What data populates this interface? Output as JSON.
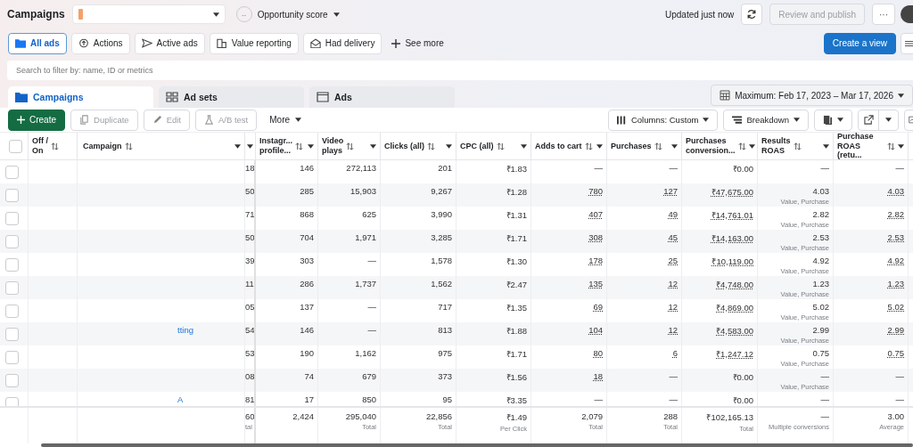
{
  "header": {
    "title": "Campaigns",
    "opportunity": {
      "badge": "--",
      "label": "Opportunity score"
    },
    "updated": "Updated just now",
    "publish": {
      "label": "Review and publish",
      "disabled": true
    },
    "more": "···"
  },
  "filters": [
    {
      "label": "All ads",
      "selected": true
    },
    {
      "label": "Actions",
      "selected": false
    },
    {
      "label": "Active ads",
      "selected": false
    },
    {
      "label": "Value reporting",
      "selected": false
    },
    {
      "label": "Had delivery",
      "selected": false
    }
  ],
  "see_more": "See more",
  "create_view": "Create a view",
  "search": {
    "placeholder": "Search to filter by: name, ID or metrics"
  },
  "tabs": [
    {
      "label": "Campaigns",
      "selected": true
    },
    {
      "label": "Ad sets",
      "selected": false
    },
    {
      "label": "Ads",
      "selected": false
    }
  ],
  "date_range": "Maximum: Feb 17, 2023 – Mar 17, 2026",
  "toolbar": [
    {
      "label": "Create",
      "kind": "primary",
      "disabled": false
    },
    {
      "label": "Duplicate",
      "kind": "button",
      "disabled": true
    },
    {
      "label": "Edit",
      "kind": "button",
      "disabled": true
    },
    {
      "label": "A/B test",
      "kind": "button",
      "disabled": true
    },
    {
      "label": "More",
      "kind": "menu",
      "disabled": false
    }
  ],
  "view_tools": [
    {
      "label": "Columns: Custom"
    },
    {
      "label": "Breakdown"
    }
  ],
  "table": {
    "all_checked": false,
    "columns": [
      "Off /\nOn",
      "Campaign",
      "Instagr...\nprofile...",
      "Video\nplays",
      "Clicks (all)",
      "CPC (all)",
      "Adds to cart",
      "Purchases",
      "Purchases\nconversion...",
      "Results\nROAS",
      "Purchase\nROAS (retu..."
    ],
    "rows": [
      {
        "checked": false,
        "column_3": "18",
        "cells": [
          "146",
          "272,113",
          "201",
          "₹1.83",
          "—",
          "—",
          "₹0.00",
          "—",
          "—"
        ]
      },
      {
        "checked": false,
        "column_3": "50",
        "cells": [
          "285",
          "15,903",
          "9,267",
          "₹1.28",
          {
            "text": "780",
            "link": true
          },
          {
            "text": "127",
            "link": true
          },
          {
            "text": "₹47,675.00",
            "link": true
          },
          {
            "text": "4.03",
            "note": "Value, Purchase"
          },
          {
            "text": "4.03",
            "link": true
          }
        ]
      },
      {
        "checked": false,
        "column_3": "71",
        "cells": [
          "868",
          "625",
          "3,990",
          "₹1.31",
          {
            "text": "407",
            "link": true
          },
          {
            "text": "49",
            "link": true
          },
          {
            "text": "₹14,761.01",
            "link": true
          },
          {
            "text": "2.82",
            "note": "Value, Purchase"
          },
          {
            "text": "2.82",
            "link": true
          }
        ]
      },
      {
        "checked": false,
        "column_3": "50",
        "cells": [
          "704",
          "1,971",
          "3,285",
          "₹1.71",
          {
            "text": "308",
            "link": true
          },
          {
            "text": "45",
            "link": true
          },
          {
            "text": "₹14,163.00",
            "link": true
          },
          {
            "text": "2.53",
            "note": "Value, Purchase"
          },
          {
            "text": "2.53",
            "link": true
          }
        ]
      },
      {
        "checked": false,
        "column_3": "39",
        "cells": [
          "303",
          "—",
          "1,578",
          "₹1.30",
          {
            "text": "178",
            "link": true
          },
          {
            "text": "25",
            "link": true
          },
          {
            "text": "₹10,119.00",
            "link": true
          },
          {
            "text": "4.92",
            "note": "Value, Purchase"
          },
          {
            "text": "4.92",
            "link": true
          }
        ]
      },
      {
        "checked": false,
        "column_3": "11",
        "cells": [
          "286",
          "1,737",
          "1,562",
          "₹2.47",
          {
            "text": "135",
            "link": true
          },
          {
            "text": "12",
            "link": true
          },
          {
            "text": "₹4,748.00",
            "link": true
          },
          {
            "text": "1.23",
            "note": "Value, Purchase"
          },
          {
            "text": "1.23",
            "link": true
          }
        ]
      },
      {
        "checked": false,
        "column_3": "05",
        "cells": [
          "137",
          "—",
          "717",
          "₹1.35",
          {
            "text": "69",
            "link": true
          },
          {
            "text": "12",
            "link": true
          },
          {
            "text": "₹4,869.00",
            "link": true
          },
          {
            "text": "5.02",
            "note": "Value, Purchase"
          },
          {
            "text": "5.02",
            "link": true
          }
        ]
      },
      {
        "checked": false,
        "name": "tting",
        "column_3": "54",
        "cells": [
          "146",
          "—",
          "813",
          "₹1.88",
          {
            "text": "104",
            "link": true
          },
          {
            "text": "12",
            "link": true
          },
          {
            "text": "₹4,583.00",
            "link": true
          },
          {
            "text": "2.99",
            "note": "Value, Purchase"
          },
          {
            "text": "2.99",
            "link": true
          }
        ]
      },
      {
        "checked": false,
        "column_3": "53",
        "cells": [
          "190",
          "1,162",
          "975",
          "₹1.71",
          {
            "text": "80",
            "link": true
          },
          {
            "text": "6",
            "link": true
          },
          {
            "text": "₹1,247.12",
            "link": true
          },
          {
            "text": "0.75",
            "note": "Value, Purchase"
          },
          {
            "text": "0.75",
            "link": true
          }
        ]
      },
      {
        "checked": false,
        "column_3": "08",
        "cells": [
          "74",
          "679",
          "373",
          "₹1.56",
          {
            "text": "18",
            "link": true
          },
          "—",
          "₹0.00",
          {
            "text": "—",
            "note": "Value, Purchase"
          },
          "—"
        ]
      },
      {
        "checked": false,
        "name": "A",
        "column_3": "81",
        "cells": [
          "17",
          "850",
          "95",
          "₹3.35",
          "—",
          "—",
          "₹0.00",
          "—",
          "—"
        ]
      }
    ],
    "totals": [
      {
        "text": "60",
        "note": "tal"
      },
      {
        "text": "2,424"
      },
      {
        "text": "295,040",
        "note": "Total"
      },
      {
        "text": "22,856",
        "note": "Total"
      },
      {
        "text": "₹1.49",
        "note": "Per Click"
      },
      {
        "text": "2,079",
        "note": "Total"
      },
      {
        "text": "288",
        "note": "Total"
      },
      {
        "text": "₹102,165.13",
        "note": "Total"
      },
      {
        "text": "—",
        "note": "Multiple conversions"
      },
      {
        "text": "3.00",
        "note": "Average"
      }
    ]
  }
}
